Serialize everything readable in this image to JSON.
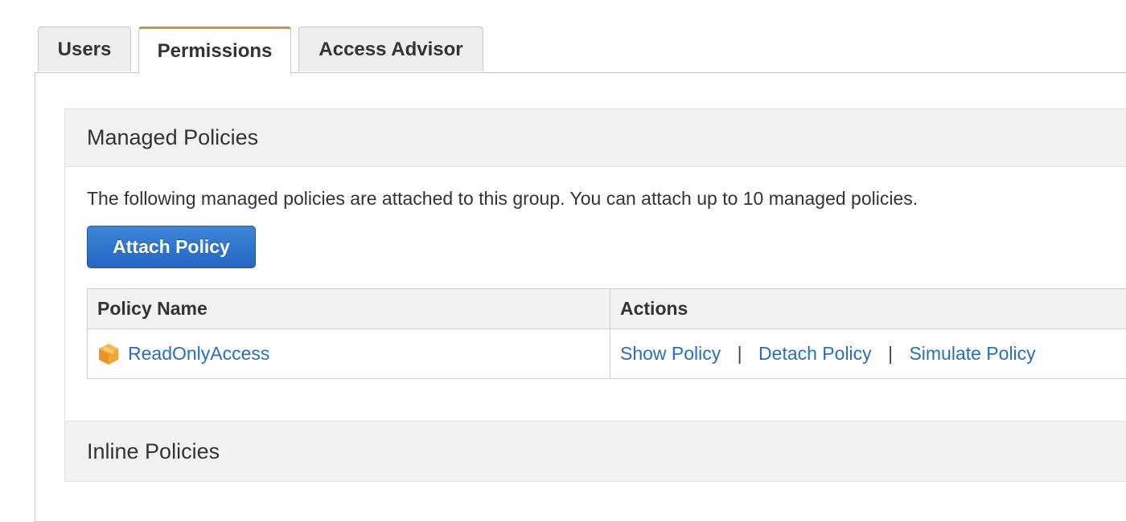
{
  "tabs": [
    {
      "label": "Users",
      "active": false
    },
    {
      "label": "Permissions",
      "active": true
    },
    {
      "label": "Access Advisor",
      "active": false
    }
  ],
  "managed": {
    "title": "Managed Policies",
    "description": "The following managed policies are attached to this group. You can attach up to 10 managed policies.",
    "attach_label": "Attach Policy",
    "table": {
      "headers": [
        "Policy Name",
        "Actions"
      ],
      "rows": [
        {
          "name": "ReadOnlyAccess",
          "icon": "policy-box-icon",
          "actions": [
            "Show Policy",
            "Detach Policy",
            "Simulate Policy"
          ],
          "separator": "|"
        }
      ]
    }
  },
  "inline": {
    "title": "Inline Policies"
  },
  "colors": {
    "active_tab_accent": "#dd8a3c",
    "primary_button": "#2a6ec6",
    "link": "#2a6ebb",
    "policy_icon": "#f0a030"
  }
}
